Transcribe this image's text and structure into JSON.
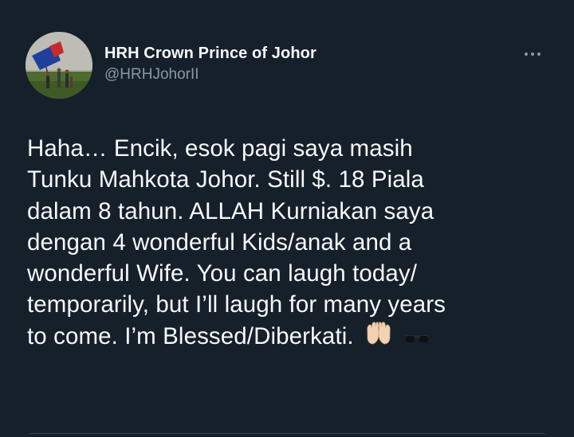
{
  "tweet": {
    "author": {
      "display_name": "HRH Crown Prince of Johor",
      "handle": "@HRHJohorII"
    },
    "menu_icon": "more-horizontal-icon",
    "body_lines": [
      "Haha… Encik, esok pagi saya masih",
      "Tunku Mahkota Johor. Still $. 18 Piala",
      "dalam 8 tahun. ALLAH Kurniakan saya",
      "dengan 4 wonderful Kids/anak and a",
      "wonderful Wife. You can laugh today/",
      "temporarily, but I’ll laugh for many years",
      "to come. I’m Blessed/Diberkati."
    ],
    "emojis": [
      "palms-up-together-icon",
      "sunglasses-icon"
    ]
  },
  "colors": {
    "background": "#15202b",
    "text_primary": "#f7f9f9",
    "text_secondary": "#8b98a5"
  }
}
